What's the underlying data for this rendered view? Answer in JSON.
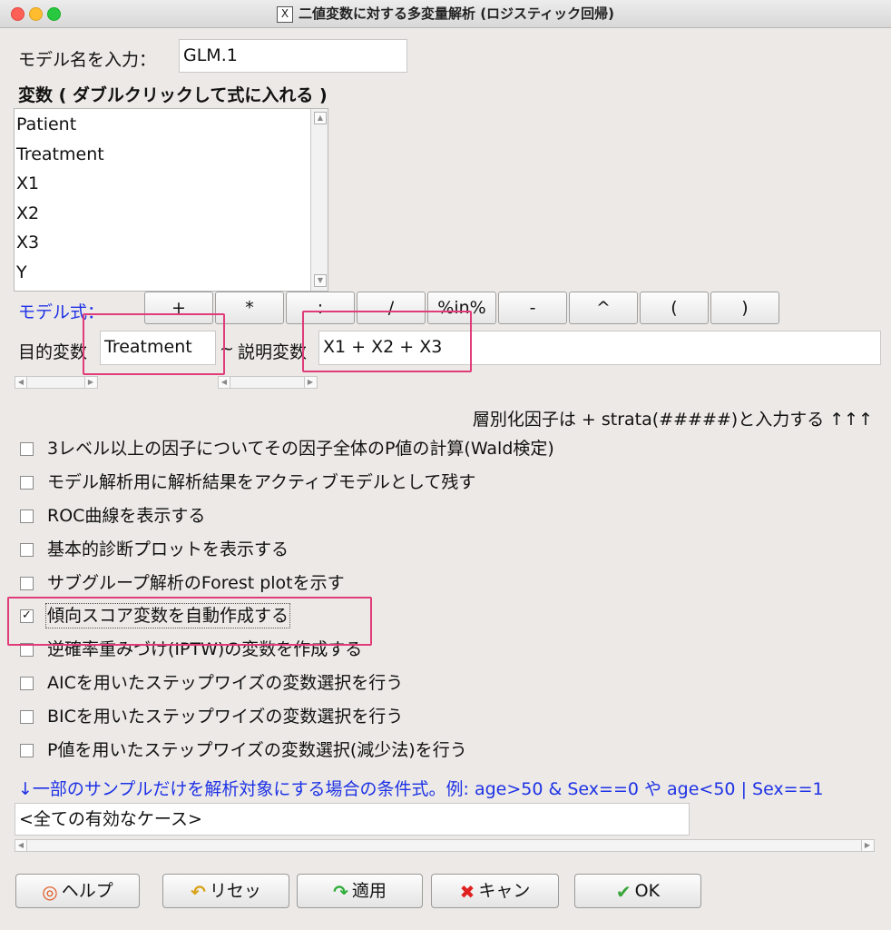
{
  "window": {
    "title": "二値変数に対する多変量解析 (ロジスティック回帰)"
  },
  "model_name": {
    "label": "モデル名を入力：",
    "value": "GLM.1"
  },
  "variables": {
    "header": "変数 ( ダブルクリックして式に入れる )",
    "items": [
      "Patient",
      "Treatment",
      "X1",
      "X2",
      "X3",
      "Y"
    ]
  },
  "formula": {
    "label": "モデル式：",
    "operators": [
      "+",
      "*",
      ":",
      "/",
      "%in%",
      "-",
      "^",
      "(",
      ")"
    ],
    "response_label": "目的変数",
    "response_value": "Treatment",
    "tilde": "~",
    "explanatory_label": "説明変数",
    "explanatory_value": "X1 + X2 + X3"
  },
  "strata_note": "層別化因子は + strata(#####)と入力する ↑↑↑",
  "options": [
    {
      "label": "3レベル以上の因子についてその因子全体のP値の計算(Wald検定)",
      "checked": false
    },
    {
      "label": "モデル解析用に解析結果をアクティブモデルとして残す",
      "checked": false
    },
    {
      "label": "ROC曲線を表示する",
      "checked": false
    },
    {
      "label": "基本的診断プロットを表示する",
      "checked": false
    },
    {
      "label": "サブグループ解析のForest plotを示す",
      "checked": false
    },
    {
      "label": "傾向スコア変数を自動作成する",
      "checked": true
    },
    {
      "label": "逆確率重みづけ(IPTW)の変数を作成する",
      "checked": false
    },
    {
      "label": "AICを用いたステップワイズの変数選択を行う",
      "checked": false
    },
    {
      "label": "BICを用いたステップワイズの変数選択を行う",
      "checked": false
    },
    {
      "label": "P値を用いたステップワイズの変数選択(減少法)を行う",
      "checked": false
    }
  ],
  "subset": {
    "note": "↓一部のサンプルだけを解析対象にする場合の条件式。例: age>50 & Sex==0 や age<50 | Sex==1",
    "value": "<全ての有効なケース>"
  },
  "buttons": {
    "help": "ヘルプ",
    "reset": "リセッ",
    "apply": "適用",
    "cancel": "キャン",
    "ok": "OK"
  },
  "colors": {
    "accent_blue": "#1e32e6",
    "highlight": "#e03c7a",
    "background": "#ece9e6"
  }
}
